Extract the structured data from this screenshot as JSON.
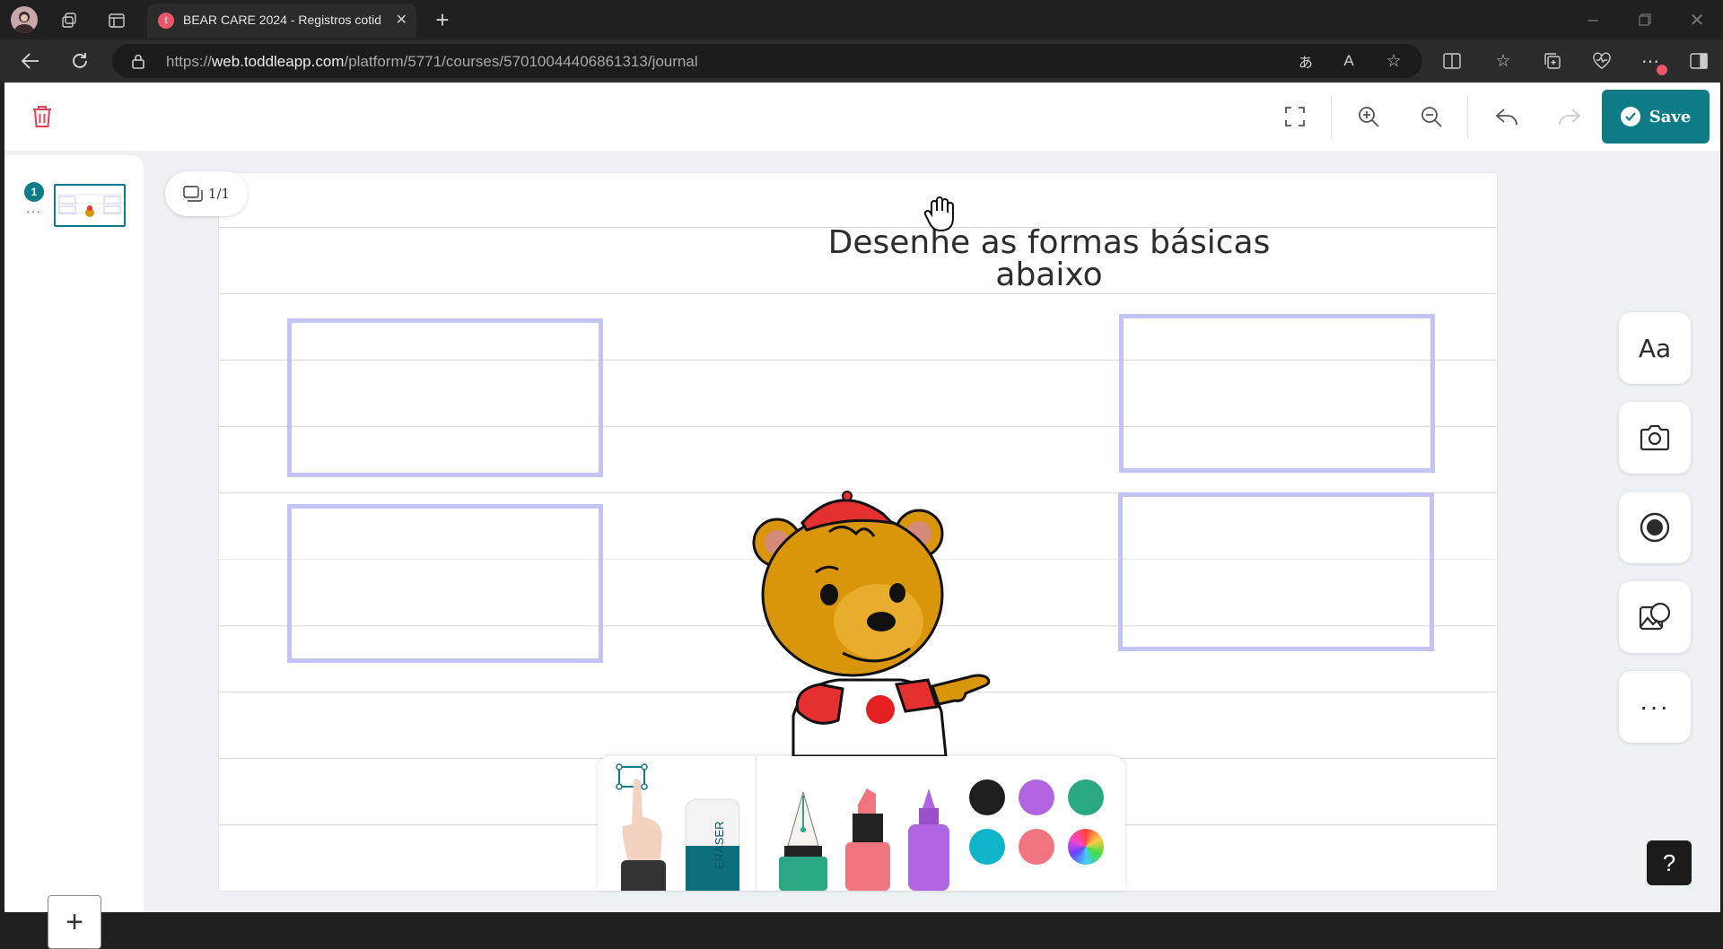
{
  "browser": {
    "tab_title": "BEAR CARE 2024 - Registros cotid",
    "tab_favicon_letter": "t",
    "url_prefix": "https://",
    "url_host": "web.toddleapp.com",
    "url_path": "/platform/5771/courses/57010044406861313/journal",
    "icons": [
      "profile-avatar",
      "workspaces-icon",
      "tab-actions-icon",
      "close-tab-icon",
      "new-tab-icon",
      "minimize-icon",
      "restore-icon",
      "close-window-icon",
      "back-icon",
      "refresh-icon",
      "lock-icon",
      "translate-icon",
      "read-aloud-icon",
      "favorite-icon",
      "split-screen-icon",
      "favorites-icon",
      "collections-icon",
      "browser-essentials-icon",
      "more-icon",
      "sidebar-icon"
    ]
  },
  "toolbar": {
    "save_label": "Save",
    "icons": [
      "trash-icon",
      "fullscreen-icon",
      "zoom-in-icon",
      "zoom-out-icon",
      "undo-icon",
      "redo-icon"
    ]
  },
  "sidebar": {
    "page_number": "1",
    "add_label": "+"
  },
  "canvas": {
    "page_count": "1/1",
    "title_line1": "Desenhe as formas básicas",
    "title_line2": "abaixo",
    "shape_box_color": "#c4c3f5"
  },
  "right_tools": [
    "text-tool-icon",
    "camera-icon",
    "record-icon",
    "image-icon",
    "more-options-icon"
  ],
  "right_tools_text_label": "Aa",
  "help_label": "?",
  "drawing_toolbar": {
    "tools": [
      "select-hand-tool",
      "eraser-tool",
      "pen-tool",
      "marker-tool",
      "highlighter-tool"
    ],
    "eraser_text": "ERASER",
    "colors": [
      "#1e1e1e",
      "#b265e0",
      "#2aa884",
      "#0fb4c9",
      "#f07580",
      "color-wheel"
    ]
  }
}
